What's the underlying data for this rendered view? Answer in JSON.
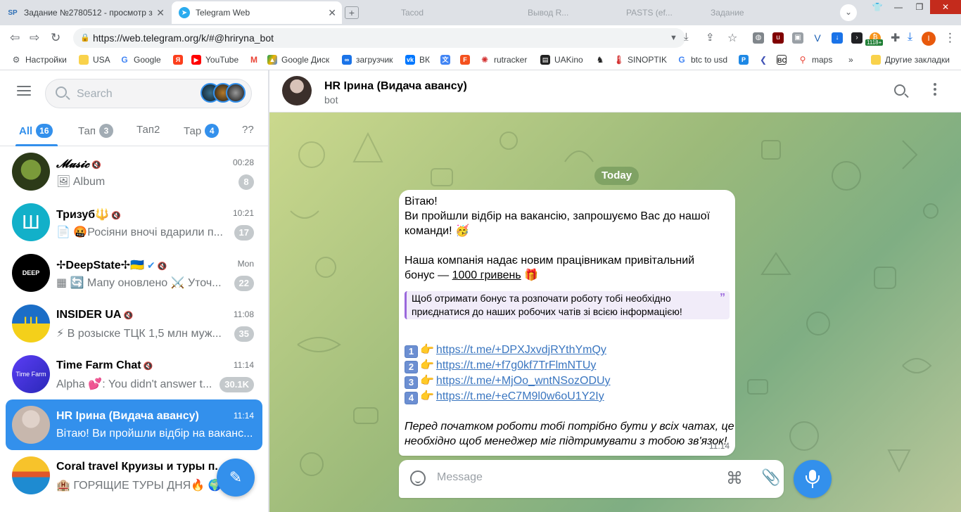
{
  "browser": {
    "tabs": [
      {
        "label": "Задание №2780512 - просмотр з",
        "favicon": "SP",
        "active": false
      },
      {
        "label": "Telegram Web",
        "favicon": "telegram",
        "active": true
      }
    ],
    "ghost_tabs": [
      "Tacod",
      "Вывод R...",
      "PASTS (ef...",
      "Задание"
    ],
    "address": "https://web.telegram.org/k/#@hriryna_bot",
    "ext_badge": "1118+",
    "bookmarks": [
      {
        "label": "Настройки",
        "icon": "gear-icon"
      },
      {
        "label": "USA",
        "icon": "folder-icon"
      },
      {
        "label": "Google",
        "icon": "google-icon"
      },
      {
        "label": "",
        "icon": "yandex-icon"
      },
      {
        "label": "YouTube",
        "icon": "youtube-icon"
      },
      {
        "label": "",
        "icon": "gmail-icon"
      },
      {
        "label": "Google Диск",
        "icon": "drive-icon"
      },
      {
        "label": "загрузчик",
        "icon": "loop-icon"
      },
      {
        "label": "ВК",
        "icon": "vk-icon"
      },
      {
        "label": "",
        "icon": "translate-icon"
      },
      {
        "label": "",
        "icon": "f-icon"
      },
      {
        "label": "rutracker",
        "icon": "rutracker-icon"
      },
      {
        "label": "UAKino",
        "icon": "film-icon"
      },
      {
        "label": "",
        "icon": "chess-icon"
      },
      {
        "label": "SINOPTIK",
        "icon": "thermometer-icon"
      },
      {
        "label": "btc to usd",
        "icon": "google-icon"
      },
      {
        "label": "",
        "icon": "p-icon"
      },
      {
        "label": "",
        "icon": "arrow-icon"
      },
      {
        "label": "",
        "icon": "bc-icon"
      },
      {
        "label": "maps",
        "icon": "maps-icon"
      },
      {
        "label": "»",
        "icon": ""
      },
      {
        "label": "Другие закладки",
        "icon": "folder-icon"
      }
    ]
  },
  "sidebar": {
    "search_placeholder": "Search",
    "folders": [
      {
        "label": "All",
        "count": "16",
        "active": true
      },
      {
        "label": "Тап",
        "count": "3",
        "active": false
      },
      {
        "label": "Тап2",
        "count": "",
        "active": false
      },
      {
        "label": "Тар",
        "count": "4",
        "active": false
      },
      {
        "label": "??",
        "count": "",
        "active": false
      }
    ],
    "chats": [
      {
        "name": "𝓜𝓾𝓼𝓲𝓬",
        "muted": true,
        "time": "00:28",
        "preview": "🖼 Album",
        "badge": "8",
        "active": false,
        "avatar_color": "#4a5a2a"
      },
      {
        "name": "Тризуб🔱",
        "muted": true,
        "time": "10:21",
        "preview": "📄 🤬Росіяни вночі вдарили п...",
        "badge": "17",
        "active": false,
        "avatar_color": "#12b0c9"
      },
      {
        "name": "✢DeepState✢🇺🇦",
        "muted": true,
        "verified": true,
        "time": "Mon",
        "preview": "▦ 🔄 Мапу оновлено ⚔️ Уточ...",
        "badge": "22",
        "active": false,
        "avatar_color": "#000000"
      },
      {
        "name": "INSIDER UA",
        "muted": true,
        "time": "11:08",
        "preview": "⚡ В розыске ТЦК 1,5 млн муж...",
        "badge": "35",
        "active": false,
        "avatar_color": "#1b6ec7"
      },
      {
        "name": "Time Farm Chat",
        "muted": true,
        "time": "11:14",
        "preview": "Alpha 💕: You didn't answer t...",
        "badge": "30.1K",
        "active": false,
        "avatar_color": "#3f3be0"
      },
      {
        "name": "HR Ірина (Видача авансу)",
        "muted": false,
        "time": "11:14",
        "preview": "Вітаю! Ви пройшли відбір на ваканс...",
        "badge": "",
        "active": true,
        "avatar_color": "#d9cfc9"
      },
      {
        "name": "Coral travel Круизы и туры п...",
        "muted": false,
        "time": "",
        "preview": "🏨 ГОРЯЩИЕ ТУРЫ ДНЯ🔥 🌍 ...",
        "badge": "",
        "active": false,
        "avatar_color": "#f3b21a"
      }
    ]
  },
  "conversation": {
    "title": "HR Ірина (Видача авансу)",
    "subtitle": "bot",
    "date": "Today",
    "message": {
      "greeting": "Вітаю!",
      "line1": "Ви пройшли відбір на вакансію, запрошуємо Вас до нашої",
      "line2": "команди! 🥳",
      "line3": "Наша компанія надає новим працівникам привітальний",
      "line4_pre": "бонус — ",
      "bonus": "1000 гривень",
      "line4_post": " 🎁",
      "quote_l1": "Щоб отримати бонус та розпочати роботу тобі необхідно",
      "quote_l2": "приєднатися до наших робочих чатів зі всією інформацією!",
      "links": [
        {
          "num": "1",
          "url": "https://t.me/+DPXJxvdjRYthYmQy"
        },
        {
          "num": "2",
          "url": "https://t.me/+f7g0kf7TrFlmNTUy"
        },
        {
          "num": "3",
          "url": "https://t.me/+MjOo_wntNSozODUy"
        },
        {
          "num": "4",
          "url": "https://t.me/+eC7M9l0w6oU1Y2Iy"
        }
      ],
      "closing_l1": "Перед початком роботи тобі потрібно бути у всіх чатах, це",
      "closing_l2": "необхідно щоб менеджер міг підтримувати з тобою зв'язок!",
      "time": "11:14"
    },
    "composer_placeholder": "Message"
  },
  "colors": {
    "accent": "#3390ec",
    "quote_border": "#9a68dc"
  }
}
